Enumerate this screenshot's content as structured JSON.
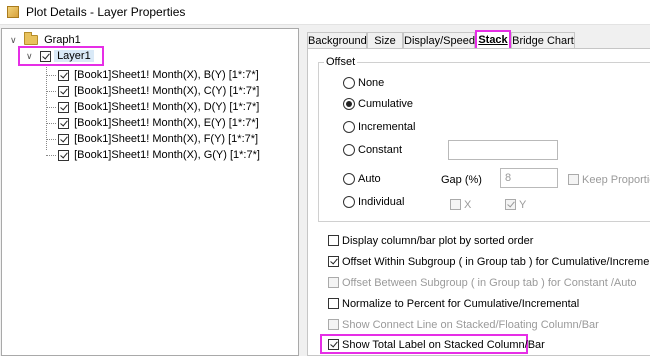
{
  "window": {
    "title": "Plot Details - Layer Properties"
  },
  "tree": {
    "root": "Graph1",
    "layer": "Layer1",
    "plots": [
      "[Book1]Sheet1! Month(X), B(Y) [1*:7*]",
      "[Book1]Sheet1! Month(X), C(Y) [1*:7*]",
      "[Book1]Sheet1! Month(X), D(Y) [1*:7*]",
      "[Book1]Sheet1! Month(X), E(Y) [1*:7*]",
      "[Book1]Sheet1! Month(X), F(Y) [1*:7*]",
      "[Book1]Sheet1! Month(X), G(Y) [1*:7*]"
    ]
  },
  "tabs": [
    "Background",
    "Size",
    "Display/Speed",
    "Stack",
    "Bridge Chart"
  ],
  "active_tab": "Stack",
  "offset": {
    "title": "Offset",
    "options": [
      "None",
      "Cumulative",
      "Incremental",
      "Constant",
      "Auto",
      "Individual"
    ],
    "selected": "Cumulative",
    "constant_value": "",
    "gap_label": "Gap (%)",
    "gap_value": "8",
    "keep_proportion": "Keep Proportion",
    "x_label": "X",
    "y_label": "Y"
  },
  "options": [
    {
      "label": "Display column/bar plot by sorted order",
      "checked": false,
      "enabled": true
    },
    {
      "label": "Offset Within Subgroup ( in Group tab ) for Cumulative/Incremental",
      "checked": true,
      "enabled": true
    },
    {
      "label": "Offset Between Subgroup ( in Group tab ) for Constant /Auto",
      "checked": false,
      "enabled": false
    },
    {
      "label": "Normalize to Percent for Cumulative/Incremental",
      "checked": false,
      "enabled": true
    },
    {
      "label": "Show Connect Line on Stacked/Floating Column/Bar",
      "checked": false,
      "enabled": false
    },
    {
      "label": "Show Total Label on Stacked Column/Bar",
      "checked": true,
      "enabled": true
    }
  ],
  "colors": {
    "highlight": "#e62ee6",
    "selection": "#d9e9f7"
  }
}
